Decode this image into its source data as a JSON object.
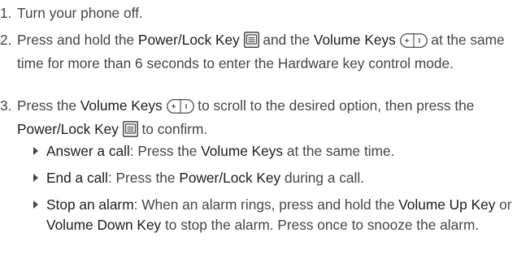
{
  "steps": [
    {
      "number": "1.",
      "text": "Turn your phone off."
    },
    {
      "number": "2.",
      "t1": "Press and hold the ",
      "k1": "Power/Lock Key",
      "t2": " and the ",
      "k2": "Volume Keys",
      "t3": " at the same time for more than 6 seconds to enter the Hardware key control mode."
    },
    {
      "number": "3.",
      "t1": "Press the ",
      "k1": "Volume Keys",
      "t2": " to scroll to the desired option, then press the ",
      "k2": "Power/Lock Key",
      "t3": " to confirm."
    }
  ],
  "bullets": [
    {
      "title": "Answer a call",
      "t1": ": Press the ",
      "k1": "Volume Keys",
      "t2": " at the same time."
    },
    {
      "title": "End a call",
      "t1": ": Press the ",
      "k1": "Power/Lock Key",
      "t2": " during a call."
    },
    {
      "title": "Stop an alarm",
      "t1": ": When an alarm rings, press and hold the ",
      "k1": "Volume Up Key",
      "t2": " or ",
      "k2": "Volume Down Key",
      "t3": " to stop the alarm. Press once to snooze the alarm."
    }
  ],
  "icons": [
    "power-lock-key-icon",
    "volume-keys-icon"
  ]
}
